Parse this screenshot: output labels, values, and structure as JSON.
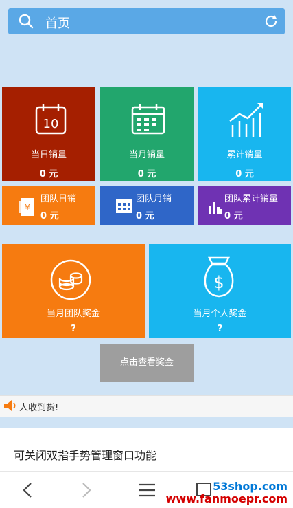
{
  "search": {
    "title": "首页",
    "search_icon": "search-icon",
    "refresh_icon": "refresh-icon"
  },
  "tiles_top": [
    {
      "label": "当日销量",
      "value": "0 元",
      "color": "#a51f00",
      "icon": "calendar-day-icon",
      "badge": "10"
    },
    {
      "label": "当月销量",
      "value": "0 元",
      "color": "#22a66d",
      "icon": "calendar-grid-icon"
    },
    {
      "label": "累计销量",
      "value": "0 元",
      "color": "#18b6ef",
      "icon": "trend-chart-icon"
    }
  ],
  "tiles_mid": [
    {
      "label": "团队日销",
      "value": "0 元",
      "color": "#f67b10",
      "icon": "yuan-note-icon"
    },
    {
      "label": "团队月销",
      "value": "0 元",
      "color": "#2f66c8",
      "icon": "calendar-small-icon"
    },
    {
      "label": "团队累计销量",
      "value": "0 元",
      "color": "#6f32b3",
      "icon": "bar-chart-icon"
    }
  ],
  "tiles_big": [
    {
      "label": "当月团队奖金",
      "value": "?",
      "color": "#f67b10",
      "icon": "coins-icon"
    },
    {
      "label": "当月个人奖金",
      "value": "?",
      "color": "#18b6ef",
      "icon": "money-bag-icon"
    }
  ],
  "check_button": "点击查看奖金",
  "ticker": {
    "text": "人收到货!",
    "icon": "speaker-icon"
  },
  "tip": "可关闭双指手势管理窗口功能",
  "watermarks": {
    "site": "53shop.com",
    "site2": "www.fanmoepr.com"
  }
}
